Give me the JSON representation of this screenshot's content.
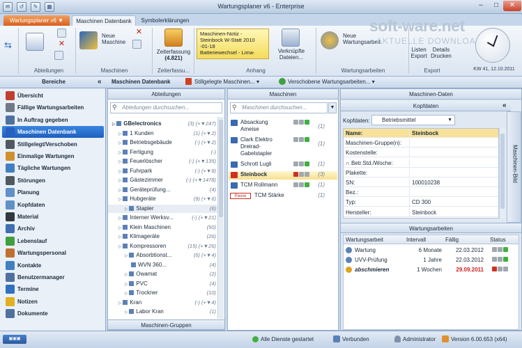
{
  "window": {
    "title": "Wartungsplaner v6 - Enterprise"
  },
  "tabs": {
    "app_menu": "Wartungsplaner v6",
    "maschinen": "Maschinen Datenbank",
    "symbol": "Symbolerklärungen"
  },
  "ribbon": {
    "groups": {
      "abteilungen": "Abteilungen",
      "maschinen": "Maschinen",
      "zeiterfassung": "Zeiterfassu...",
      "anhang": "Anhang",
      "wartungsarbeiten": "Wartungsarbeiten",
      "export": "Export"
    },
    "neue_maschine": "Neue\nMaschine",
    "zeiterfassung": "Zeiterfassung",
    "zeit_value": "(4.821)",
    "notiz_lines": [
      "Maschinen-Notiz -",
      "Steinbock W-Statt 2010",
      "-01-18",
      "Batteriewechsel - Lima-"
    ],
    "verknuepfte": "Verknüpfte\nDateien...",
    "neue_wartungsarbeit": "Neue\nWartungsarbeit",
    "listen": "Listen\nExport",
    "details": "Details\nDrucken"
  },
  "branding": {
    "logo": "soft-ware.net",
    "logo_sub": "AKTUELLE DOWNLOADS"
  },
  "clock": {
    "date": "KW 41, 12.10.2011"
  },
  "main_bar": {
    "title": "Maschinen Datenbank",
    "stillgelegte": "Stillgelegte Maschinen...",
    "verschobene": "Verschobene Wartungsarbeiten..."
  },
  "nav": {
    "title": "Bereiche",
    "items": [
      {
        "label": "Übersicht",
        "color": "#c04030"
      },
      {
        "label": "Fällige Wartungsarbeiten",
        "color": "#707888"
      },
      {
        "label": "In Auftrag gegeben",
        "color": "#5070a0"
      },
      {
        "label": "Maschinen Datenbank",
        "color": "#2860c0"
      },
      {
        "label": "Stillgelegt/Verschoben",
        "color": "#505860"
      },
      {
        "label": "Einmalige Wartungen",
        "color": "#d09030"
      },
      {
        "label": "Tägliche Wartungen",
        "color": "#4080c0"
      },
      {
        "label": "Störungen",
        "color": "#505860"
      },
      {
        "label": "Planung",
        "color": "#6090c8"
      },
      {
        "label": "Kopfdaten",
        "color": "#6090c8"
      },
      {
        "label": "Material",
        "color": "#303840"
      },
      {
        "label": "Archiv",
        "color": "#4070b0"
      },
      {
        "label": "Lebenslauf",
        "color": "#40a040"
      },
      {
        "label": "Wartungspersonal",
        "color": "#c07030"
      },
      {
        "label": "Kontakte",
        "color": "#4080c0"
      },
      {
        "label": "Benutzermanager",
        "color": "#5070a0"
      },
      {
        "label": "Termine",
        "color": "#3070c0"
      },
      {
        "label": "Notizen",
        "color": "#e0b020"
      },
      {
        "label": "Dokumente",
        "color": "#5070a0"
      }
    ]
  },
  "abteilungen": {
    "title": "Abteilungen",
    "search_placeholder": "Abteilungen durchsuchen...",
    "rows": [
      {
        "indent": 0,
        "label": "GBelectronics",
        "count": "(3) (+▼247)",
        "bold": true
      },
      {
        "indent": 1,
        "label": "1 Kunden",
        "count": "(1) (+▼2)"
      },
      {
        "indent": 1,
        "label": "Betriebsgebäude",
        "count": "(-) (+▼2)"
      },
      {
        "indent": 1,
        "label": "Fertigung",
        "count": "(-)"
      },
      {
        "indent": 1,
        "label": "Feuerlöscher",
        "count": "(-) (+▼135)"
      },
      {
        "indent": 1,
        "label": "Fuhrpark",
        "count": "(-) (+▼8)"
      },
      {
        "indent": 1,
        "label": "Gästezimmer",
        "count": "(-) (+▼1478)"
      },
      {
        "indent": 1,
        "label": "Geräteprüfung...",
        "count": "(4)"
      },
      {
        "indent": 1,
        "label": "Hubgeräte",
        "count": "(9) (+▼6)"
      },
      {
        "indent": 2,
        "label": "Stapler",
        "count": "(6)",
        "selected": true
      },
      {
        "indent": 1,
        "label": "Interner Werksv...",
        "count": "(-) (+▼21)"
      },
      {
        "indent": 1,
        "label": "Klein Maschinen",
        "count": "(50)"
      },
      {
        "indent": 1,
        "label": "Klimageräte",
        "count": "(26)"
      },
      {
        "indent": 1,
        "label": "Kompressoren",
        "count": "(15) (+▼26)"
      },
      {
        "indent": 2,
        "label": "Absorbtionst...",
        "count": "(6) (+▼4)"
      },
      {
        "indent": 3,
        "label": "WVN 360...",
        "count": "(4)"
      },
      {
        "indent": 2,
        "label": "Owamat",
        "count": "(2)"
      },
      {
        "indent": 2,
        "label": "PVC",
        "count": "(4)"
      },
      {
        "indent": 2,
        "label": "Trockner",
        "count": "(10)"
      },
      {
        "indent": 1,
        "label": "Kran",
        "count": "(-) (+▼4)"
      },
      {
        "indent": 2,
        "label": "Labor Kran",
        "count": "(1)"
      }
    ],
    "footer": "Maschinen-Gruppen"
  },
  "maschinen": {
    "title": "Maschinen",
    "search_placeholder": "Maschinen durchsuchen...",
    "rows": [
      {
        "lines": [
          "Absackung",
          "Ameise"
        ],
        "count": "(1)",
        "dots": [
          "#a0a8b0",
          "#a0a8b0",
          "#40b040"
        ]
      },
      {
        "lines": [
          "Clark Elektro",
          "Dreirad-",
          "Gabelstapler"
        ],
        "count": "(1)",
        "dots": [
          "#a0a8b0",
          "#a0a8b0",
          "#40b040"
        ]
      },
      {
        "lines": [
          "Schrott Lugli"
        ],
        "count": "(1)",
        "dots": [
          "#a0a8b0",
          "#a0a8b0",
          "#40b040"
        ]
      },
      {
        "lines": [
          "Steinbock"
        ],
        "count": "(3)",
        "dots": [
          "#d03020",
          "#a0a8b0",
          "#a0a8b0"
        ],
        "selected": true
      },
      {
        "lines": [
          "TCM Rollmann"
        ],
        "count": "(1)",
        "dots": [
          "#a0a8b0",
          "#a0a8b0",
          "#40b040"
        ]
      },
      {
        "lines": [
          "TCM Stärke"
        ],
        "count": "(1)",
        "dots": [],
        "pause": "Pause"
      }
    ]
  },
  "maschinen_daten": {
    "title": "Maschinen-Daten",
    "kopfdaten_title": "Kopfdaten",
    "kopfdaten_label": "Kopfdaten:",
    "kopfdaten_select": "Betriebsmittel",
    "side_tab": "Maschinen-Bild",
    "rows": [
      {
        "key": "Name:",
        "value": "Steinbock",
        "highlight": true
      },
      {
        "key": "Maschinen-Gruppe(n):",
        "value": ""
      },
      {
        "key": "Kostenstelle:",
        "value": ""
      },
      {
        "key": "∩ Betr.Std./Woche:",
        "value": ""
      },
      {
        "key": "Plakette:",
        "value": ""
      },
      {
        "key": "SN:",
        "value": "100010238"
      },
      {
        "key": "Bez.:",
        "value": ""
      },
      {
        "key": "Typ:",
        "value": "CD 300"
      },
      {
        "key": "Hersteller:",
        "value": "Steinbock"
      }
    ]
  },
  "wartungsarbeiten": {
    "title": "Wartungsarbeiten",
    "headers": {
      "arbeit": "Wartungsarbeit",
      "intervall": "Intervall",
      "faellig": "Fällig",
      "status": "Status"
    },
    "rows": [
      {
        "label": "Wartung",
        "intervall": "6 Monate",
        "faellig": "22.03.2012",
        "overdue": false,
        "dots": [
          "#a0a8b0",
          "#a0a8b0",
          "#40b040"
        ]
      },
      {
        "label": "UVV-Prüfung",
        "intervall": "1 Jahre",
        "faellig": "22.03.2012",
        "overdue": false,
        "dots": [
          "#a0a8b0",
          "#a0a8b0",
          "#40b040"
        ]
      },
      {
        "label": "abschmieren",
        "intervall": "1 Wochen",
        "faellig": "29.09.2011",
        "overdue": true,
        "dots": [
          "#d03020",
          "#a0a8b0",
          "#a0a8b0"
        ]
      }
    ]
  },
  "status_bar": {
    "dienste": "Alle Dienste gestartet",
    "verbunden": "Verbunden",
    "user": "Administrator",
    "version": "Version 6.00.653 (x64)"
  }
}
